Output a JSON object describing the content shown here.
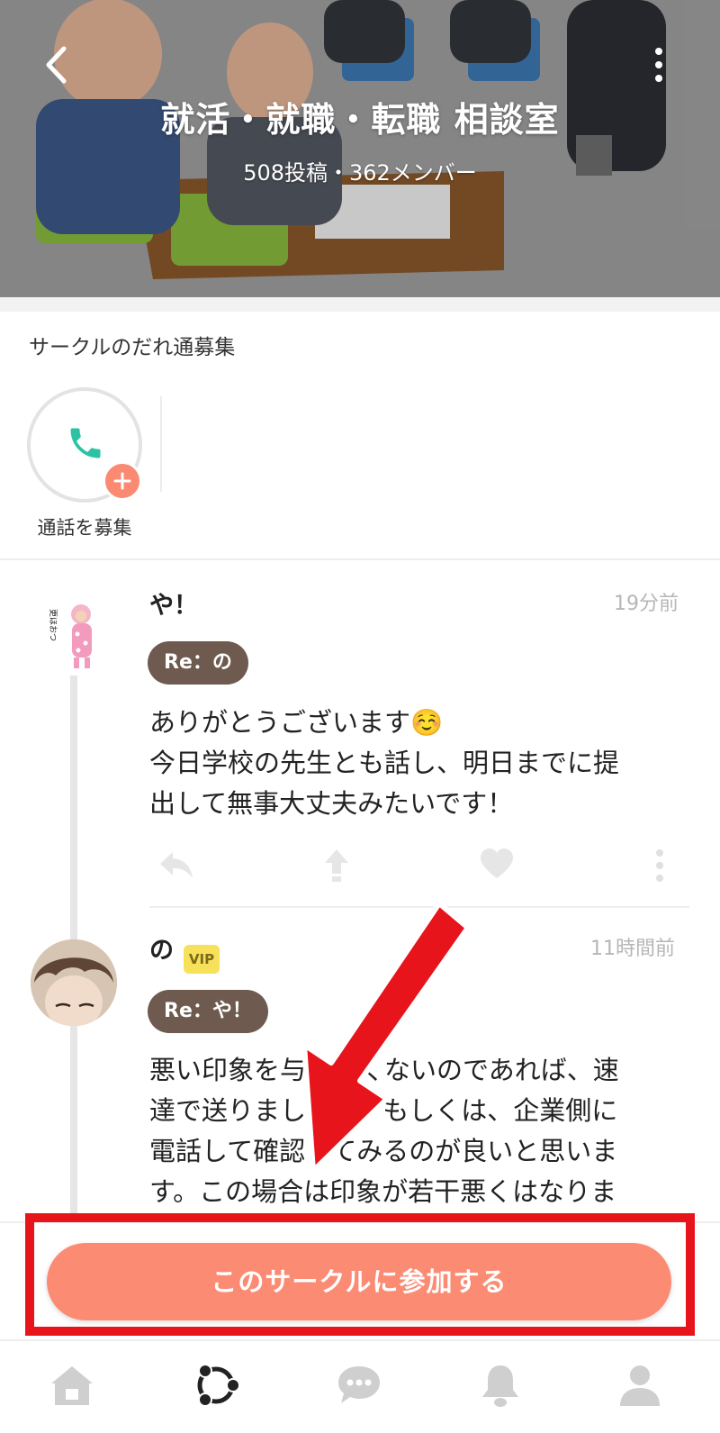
{
  "header": {
    "title": "就活・就職・転職 相談室",
    "stats": "508投稿・362メンバー"
  },
  "call_recruit": {
    "section_title": "サークルのだれ通募集",
    "button_label": "通話を募集"
  },
  "posts": [
    {
      "author": "や！",
      "time": "19分前",
      "reply_to": "Re：の",
      "lines": [
        "ありがとうございます☺️",
        "今日学校の先生とも話し、明日までに提",
        "出して無事大丈夫みたいです！"
      ]
    },
    {
      "author": "の",
      "badge": "VIP",
      "time": "11時間前",
      "reply_to": "Re：や！",
      "lines": [
        "悪い印象を与えたくないのであれば、速",
        "達で送りましょう。もしくは、企業側に",
        "電話して確認してみるのが良いと思いま",
        "す。この場合は印象が若干悪くはなりま"
      ]
    }
  ],
  "join_button": "このサークルに参加する",
  "tabs": [
    "home-icon",
    "circle-icon",
    "chat-icon",
    "bell-icon",
    "profile-icon"
  ],
  "colors": {
    "accent": "#fc8b74",
    "reply_pill": "#6e5a4f",
    "vip": "#f7e05a",
    "call_icon": "#2cc3a5",
    "highlight": "#e8141c"
  }
}
